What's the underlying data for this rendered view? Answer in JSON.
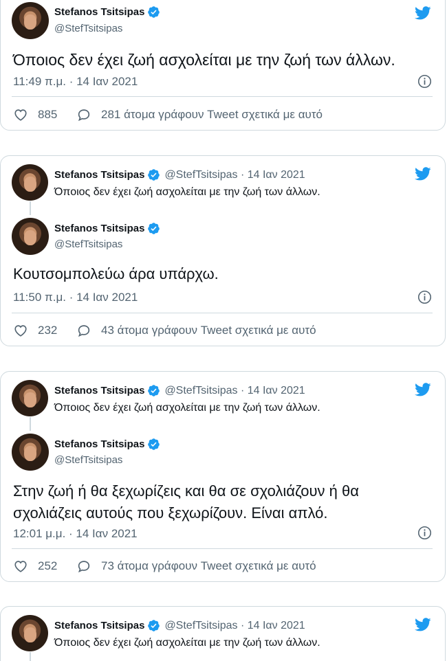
{
  "author": {
    "name": "Stefanos Tsitsipas",
    "handle": "@StefTsitsipas"
  },
  "tweets": [
    {
      "text": "Όποιος δεν έχει ζωή ασχολείται με την ζωή των άλλων.",
      "time": "11:49 π.μ. · 14 Ιαν 2021",
      "likes": "885",
      "replies": "281 άτομα γράφουν Tweet σχετικά με αυτό"
    },
    {
      "quoted_handle_date": "@StefTsitsipas · 14 Ιαν 2021",
      "quoted_text": "Όποιος δεν έχει ζωή ασχολείται με την ζωή των άλλων.",
      "text": "Κουτσομπολεύω άρα υπάρχω.",
      "time": "11:50 π.μ. · 14 Ιαν 2021",
      "likes": "232",
      "replies": "43 άτομα γράφουν Tweet σχετικά με αυτό"
    },
    {
      "quoted_handle_date": "@StefTsitsipas · 14 Ιαν 2021",
      "quoted_text": "Όποιος δεν έχει ζωή ασχολείται με την ζωή των άλλων.",
      "text_line1": "Στην ζωή ή θα ξεχωρίζεις και θα σε σχολιάζουν ή θα",
      "text_line2": "σχολιάζεις αυτούς που ξεχωρίζουν. Είναι απλό.",
      "time": "12:01 μ.μ. · 14 Ιαν 2021",
      "likes": "252",
      "replies": "73 άτομα γράφουν Tweet σχετικά με αυτό"
    },
    {
      "quoted_handle_date": "@StefTsitsipas · 14 Ιαν 2021",
      "quoted_text": "Όποιος δεν έχει ζωή ασχολείται με την ζωή των άλλων."
    }
  ],
  "colors": {
    "twitter_blue": "#1d9bf0",
    "muted": "#536471",
    "border": "#cfd9de"
  },
  "icons": [
    "twitter-bird-icon",
    "verified-badge-icon",
    "heart-icon",
    "reply-bubble-icon",
    "info-icon"
  ]
}
